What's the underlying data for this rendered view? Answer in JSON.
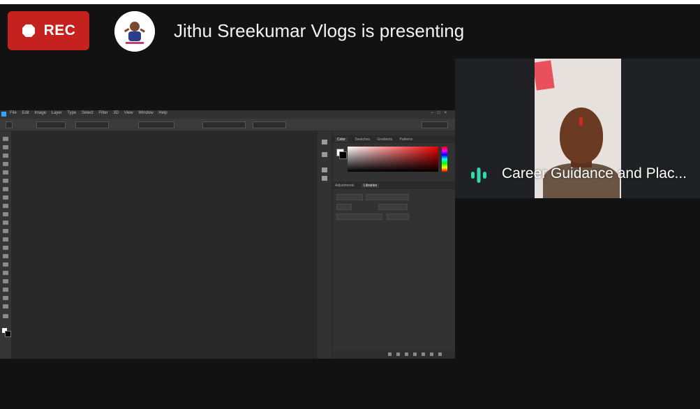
{
  "recording": {
    "label": "REC",
    "color": "#c5221f"
  },
  "presenter": {
    "text": "Jithu Sreekumar Vlogs is presenting"
  },
  "participant": {
    "name": "Career Guidance and Plac...",
    "speaking_icon": "audio-level-icon",
    "speaking_color": "#33d7b0"
  },
  "shared_screen": {
    "app": "Adobe Photoshop",
    "menu": [
      "File",
      "Edit",
      "Image",
      "Layer",
      "Type",
      "Select",
      "Filter",
      "3D",
      "View",
      "Window",
      "Help"
    ],
    "panel_tabs_top": [
      "Color",
      "Swatches",
      "Gradients",
      "Patterns"
    ],
    "panel_tabs_bottom": [
      "Adjustments",
      "Libraries"
    ],
    "accent": "#31a8ff"
  }
}
